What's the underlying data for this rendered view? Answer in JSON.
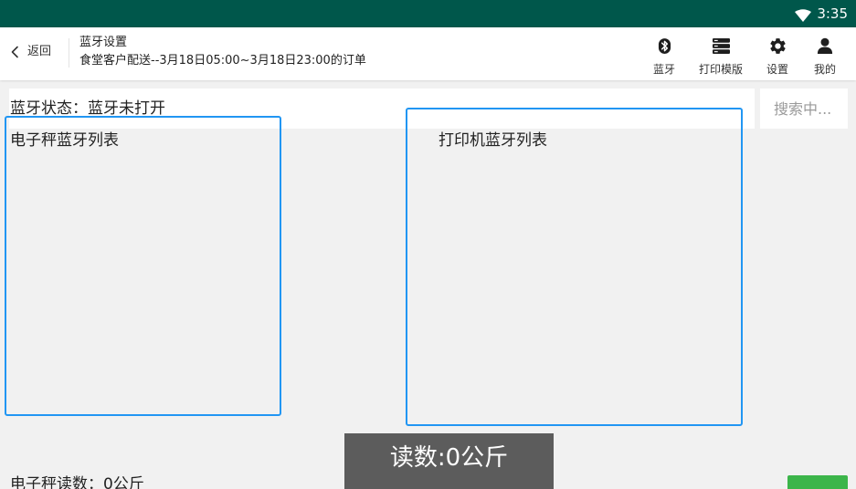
{
  "status_bar": {
    "time": "3:35",
    "icons": [
      "wifi-icon"
    ]
  },
  "header": {
    "back_icon": "chevron-left-icon",
    "back_label": "返回",
    "title": "蓝牙设置",
    "subtitle": "食堂客户配送--3月18日05:00~3月18日23:00的订单",
    "actions": [
      {
        "icon": "bluetooth-icon",
        "label": "蓝牙"
      },
      {
        "icon": "printer-template-icon",
        "label": "打印模版"
      },
      {
        "icon": "gear-icon",
        "label": "设置"
      },
      {
        "icon": "person-icon",
        "label": "我的"
      }
    ]
  },
  "bluetooth_status": {
    "text": "蓝牙状态：蓝牙未打开"
  },
  "search": {
    "value": "",
    "placeholder": "搜索中..."
  },
  "scale_list": {
    "title": "电子秤蓝牙列表",
    "items": []
  },
  "printer_list": {
    "title": "打印机蓝牙列表",
    "items": []
  },
  "scale_reading": {
    "text": "电子秤读数：0公斤"
  },
  "toast": {
    "text": "读数:0公斤"
  },
  "colors": {
    "status_bar": "#00574b",
    "page_background": "#f1f1f1",
    "list_border": "#2196f3",
    "toast_background": "#5c5c5c",
    "action_green": "#3cb54a"
  }
}
